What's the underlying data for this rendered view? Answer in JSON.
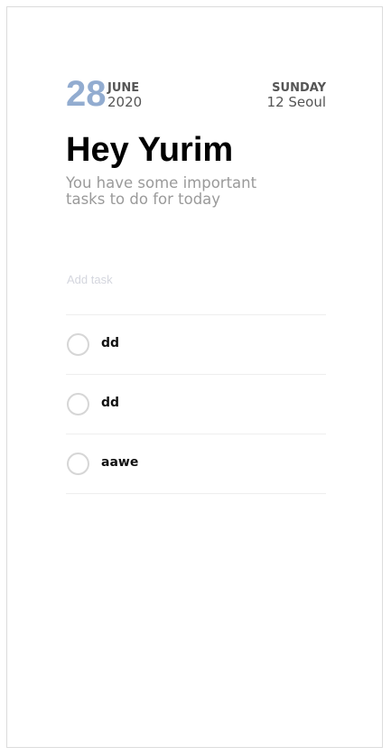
{
  "header": {
    "day": "28",
    "month": "JUNE",
    "year": "2020",
    "weekday": "SUNDAY",
    "city": "12 Seoul"
  },
  "greeting": {
    "title": "Hey Yurim",
    "subtitle": "You have some important tasks to do for today"
  },
  "add_task": {
    "placeholder": "Add task",
    "value": ""
  },
  "tasks": [
    {
      "label": "dd",
      "done": false
    },
    {
      "label": "dd",
      "done": false
    },
    {
      "label": "aawe",
      "done": false
    }
  ],
  "colors": {
    "accent": "#92acd0",
    "text_muted": "#9a9a9a",
    "divider": "#eeeeee",
    "checkbox_border": "#d6d6d6"
  }
}
